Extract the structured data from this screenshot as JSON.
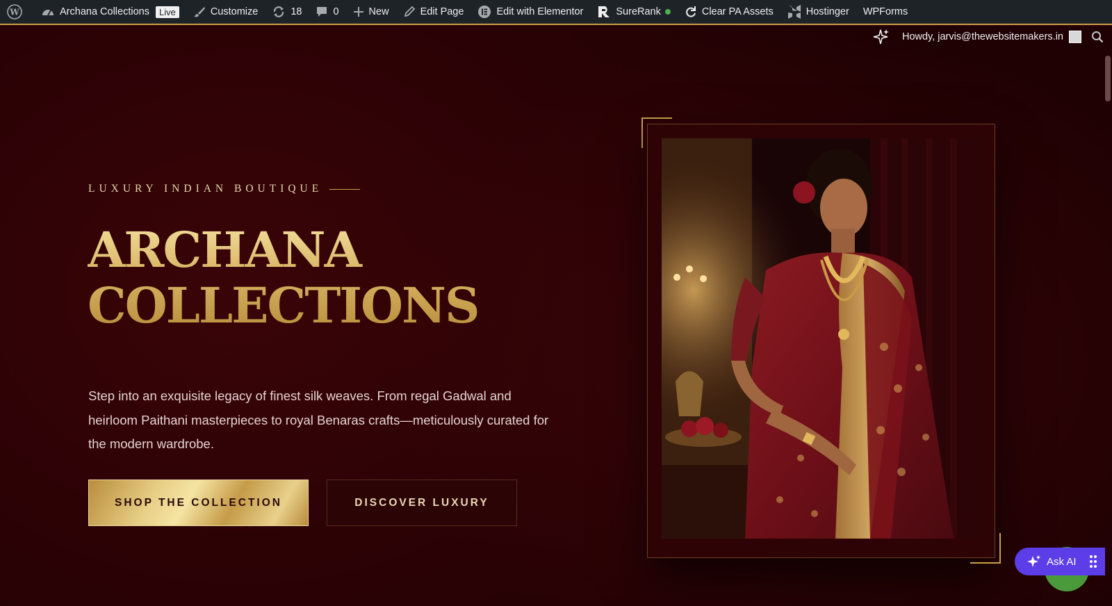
{
  "admin_bar": {
    "site_name": "Archana Collections",
    "live_badge": "Live",
    "customize": "Customize",
    "updates_count": "18",
    "comments_count": "0",
    "new": "New",
    "edit_page": "Edit Page",
    "edit_elementor": "Edit with Elementor",
    "surerank": "SureRank",
    "surerank_status_color": "#4caf50",
    "clear_pa": "Clear PA Assets",
    "hostinger": "Hostinger",
    "wpforms": "WPForms",
    "howdy": "Howdy, jarvis@thewebsitemakers.in"
  },
  "hero": {
    "eyebrow": "LUXURY INDIAN BOUTIQUE",
    "title_line1": "ARCHANA",
    "title_line2": "COLLECTIONS",
    "description": "Step into an exquisite legacy of finest silk weaves. From regal Gadwal and heirloom Paithani masterpieces to royal Benaras crafts—meticulously curated for the modern wardrobe.",
    "primary_button": "SHOP THE COLLECTION",
    "secondary_button": "DISCOVER LUXURY"
  },
  "widgets": {
    "ask_ai": "Ask AI"
  },
  "colors": {
    "accent_gold": "#c9a24a",
    "background_maroon": "#2a0305",
    "ask_ai_purple": "#5b3ee8"
  }
}
